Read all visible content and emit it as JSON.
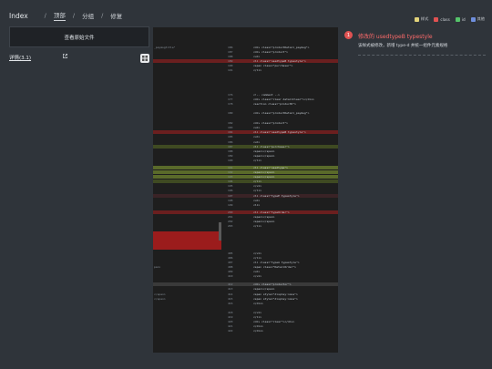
{
  "breadcrumb": {
    "title": "Index",
    "items": [
      "顶部",
      "分组",
      "修复"
    ]
  },
  "legend": [
    {
      "label": "样式",
      "color": "#e2d37a"
    },
    {
      "label": "class",
      "color": "#e05252"
    },
    {
      "label": "id",
      "color": "#55c46a"
    },
    {
      "label": "其他",
      "color": "#6f8fdd"
    }
  ],
  "left_panel": {
    "header": "查看原始文件",
    "file_label": "详情(3.1)"
  },
  "comment": {
    "number": "1",
    "title": "修改的 usedtypeB typestyle",
    "description": "该样式被修改，新增 type-d 并统一组件元素规格"
  }
}
